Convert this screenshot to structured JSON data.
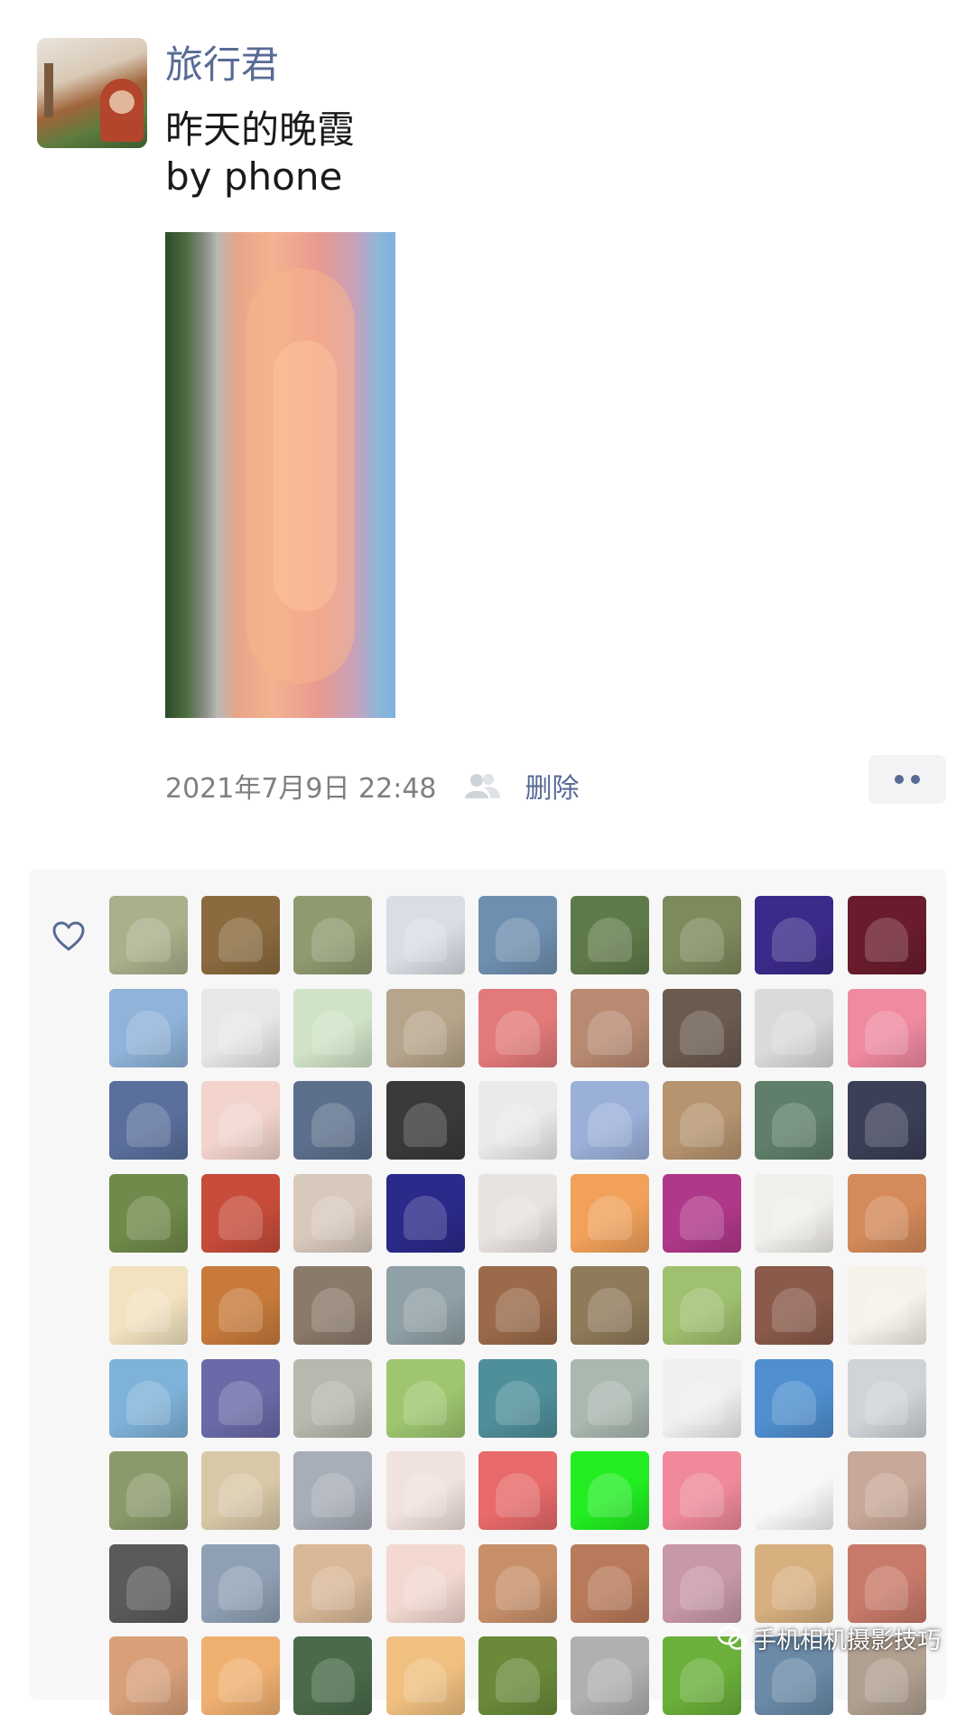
{
  "post": {
    "username": "旅行君",
    "text": "昨天的晚霞\nby phone",
    "date": "2021年7月9日 22:48",
    "delete_label": "删除"
  },
  "icons": {
    "friends": "friends-visibility-icon",
    "more": "more-dots-icon",
    "like": "heart-icon"
  },
  "colors": {
    "name_link": "#576b95",
    "panel_bg": "#f7f7f7"
  },
  "likes": {
    "avatars": [
      "#a9b08a",
      "#8a6a3e",
      "#8f9a6e",
      "#d9dde4",
      "#6f8fb0",
      "#5f7a4a",
      "#7d8a5c",
      "#3c2a8a",
      "#6a1c2c",
      "#8fb3d9",
      "#e7e7e7",
      "#cfe3c7",
      "#b6a58a",
      "#e37a7a",
      "#b98a72",
      "#6a5a4f",
      "#dadada",
      "#f08aa0",
      "#5a6f9c",
      "#f2d4cc",
      "#5c6f8c",
      "#3a3a3a",
      "#eaeaea",
      "#9bb0d9",
      "#b6946f",
      "#5f7f6a",
      "#3b3f57",
      "#6f8a4a",
      "#c74c3a",
      "#d8c9bd",
      "#2a2a8a",
      "#e8e2e0",
      "#f1a15a",
      "#b0388a",
      "#f1efeb",
      "#d48a5a",
      "#f2e2c0",
      "#c77a3a",
      "#8a7a6a",
      "#8fa0a6",
      "#9a6a4a",
      "#8f7a5a",
      "#9fc06f",
      "#8a5a4a",
      "#f5f2ea",
      "#7fb2d9",
      "#6a6aa8",
      "#b6b9ad",
      "#9fc66f",
      "#4f8f9a",
      "#aab8b0",
      "#f0f0f0",
      "#4f8fd0",
      "#cfd4d8",
      "#8a9a6a",
      "#d9c8a8",
      "#a8aeb8",
      "#f0e2dc",
      "#e86a6a",
      "#22ee22",
      "#f08a9a",
      "#f7f7f7",
      "#c8a898",
      "#5a5a5a",
      "#8fa0b4",
      "#d8b898",
      "#f2d8d0",
      "#c8906a",
      "#b87a5a",
      "#c898a8",
      "#d8b080",
      "#c87a6a",
      "#d8a07a",
      "#f0b070",
      "#4a6a4a",
      "#f0c080",
      "#6a8a3a",
      "#b0b0b0",
      "#6ab03a",
      "#6a8aa8",
      "#b0a090"
    ]
  },
  "watermark": {
    "text": "手机相机摄影技巧",
    "icon": "wechat-logo-icon"
  }
}
